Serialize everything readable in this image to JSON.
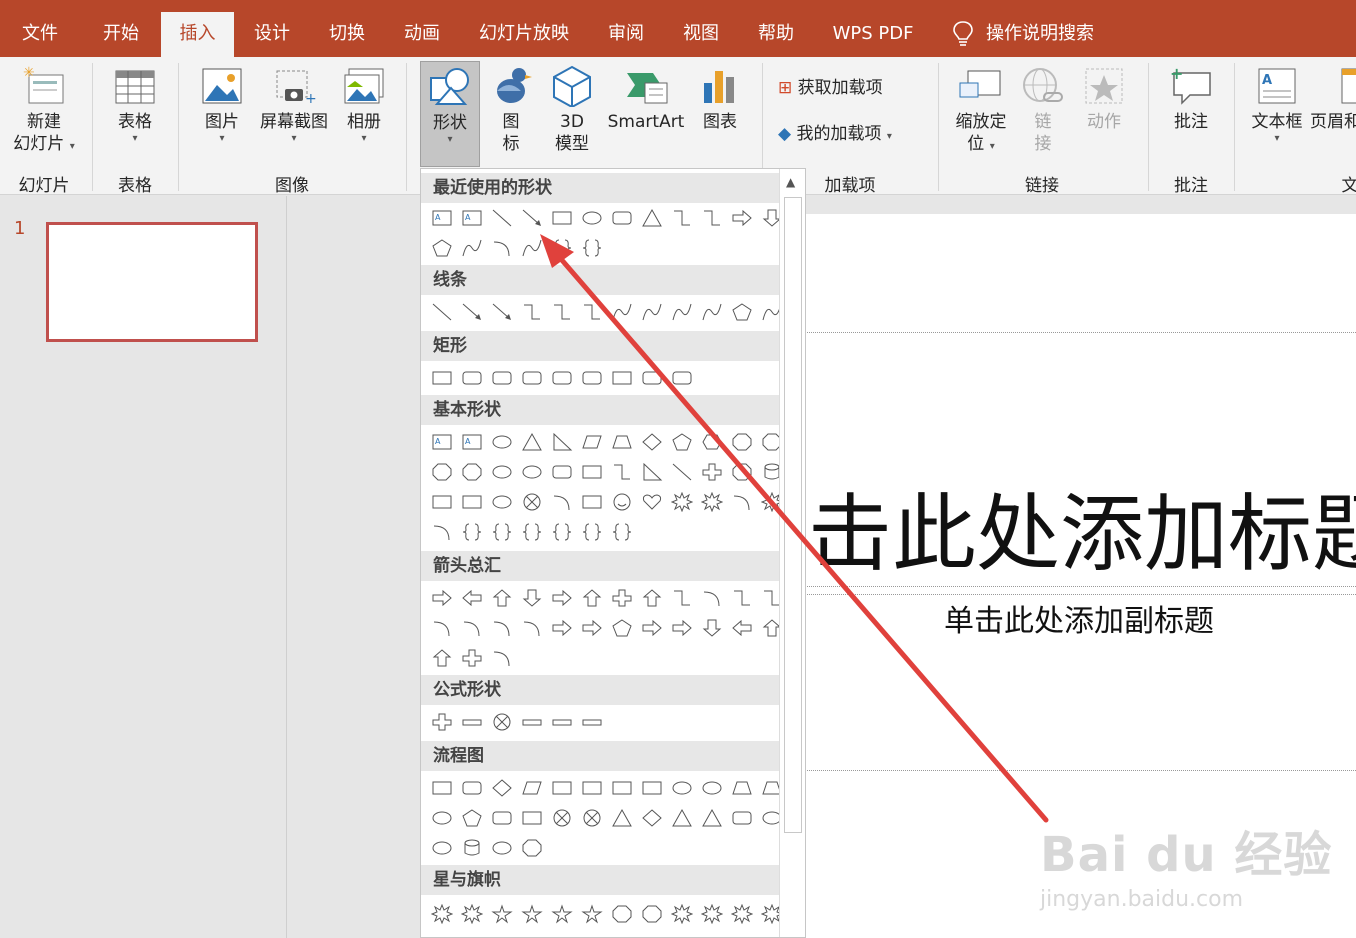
{
  "menu": {
    "tabs": [
      "文件",
      "开始",
      "插入",
      "设计",
      "切换",
      "动画",
      "幻灯片放映",
      "审阅",
      "视图",
      "帮助",
      "WPS PDF"
    ],
    "active": "插入",
    "search": "操作说明搜索"
  },
  "ribbon": {
    "new_slide": [
      "新建",
      "幻灯片"
    ],
    "table": "表格",
    "picture": "图片",
    "screenshot": "屏幕截图",
    "album": "相册",
    "shapes": "形状",
    "icons": [
      "图",
      "标"
    ],
    "model3d": [
      "3D",
      "模型"
    ],
    "smartart": "SmartArt",
    "chart": "图表",
    "get_addins": "获取加载项",
    "my_addins": "我的加载项",
    "zoom": [
      "缩放定",
      "位"
    ],
    "link": [
      "链",
      "接"
    ],
    "action": "动作",
    "comment": "批注",
    "textbox": "文本框",
    "header": "页眉和",
    "groups": {
      "slides": "幻灯片",
      "tables": "表格",
      "images": "图像",
      "addins": "加载项",
      "links": "链接",
      "comments": "批注",
      "text": "文"
    }
  },
  "slides_panel": {
    "number": "1"
  },
  "slide": {
    "title": "单击此处添加标题",
    "subtitle": "单击此处添加副标题"
  },
  "shapes_menu": {
    "sections": [
      "最近使用的形状",
      "线条",
      "矩形",
      "基本形状",
      "箭头总汇",
      "公式形状",
      "流程图",
      "星与旗帜"
    ]
  },
  "watermark": {
    "main": "Bai du 经验",
    "sub": "jingyan.baidu.com"
  },
  "colors": {
    "accent": "#b7472a",
    "arrow": "#e0413c"
  }
}
